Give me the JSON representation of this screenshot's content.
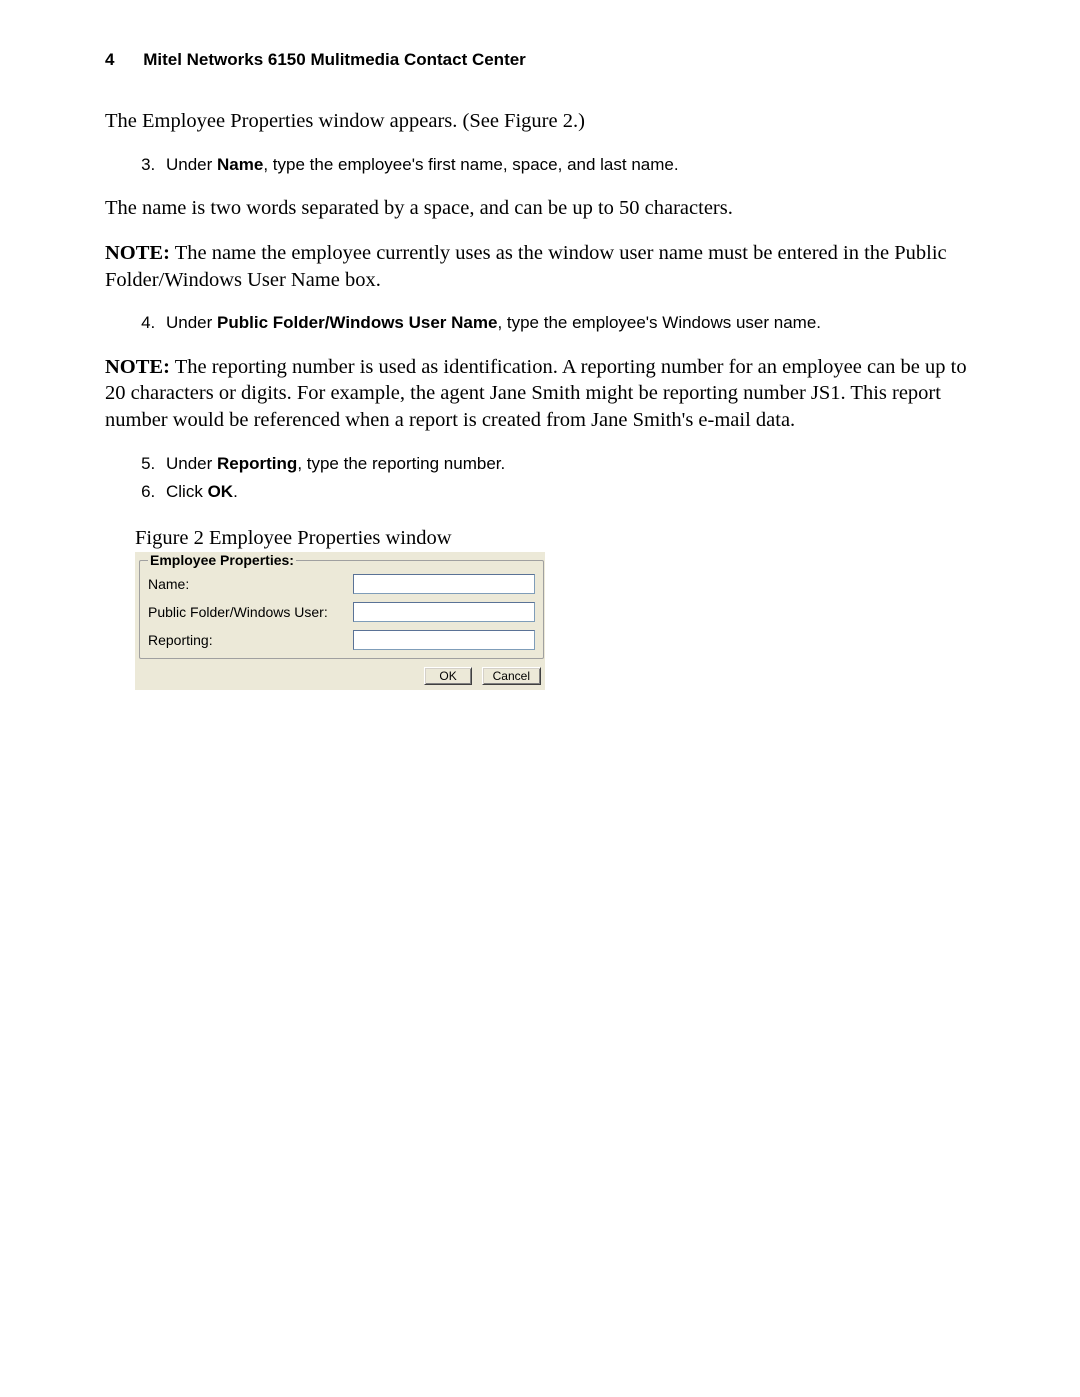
{
  "header": {
    "page_number": "4",
    "title": "Mitel Networks 6150 Mulitmedia Contact Center"
  },
  "paragraphs": {
    "intro": "The Employee Properties window appears. (See Figure 2.)",
    "name_rule": "The name is two words separated by a space, and can be up to 50 characters.",
    "note1_label": "NOTE:",
    "note1_body": " The name the employee currently uses as the window user name must be entered in the Public Folder/Windows User Name box.",
    "note2_label": "NOTE:",
    "note2_body": " The reporting number is used as identification. A reporting number for an employee can be up to 20 characters or digits. For example, the agent Jane Smith might be reporting number JS1. This report number would be referenced when a report is created from Jane Smith's e-mail data."
  },
  "steps": {
    "s3_prefix": "Under ",
    "s3_bold": "Name",
    "s3_suffix": ", type the employee's first name, space, and last name.",
    "s4_prefix": "Under ",
    "s4_bold": "Public Folder/Windows User Name",
    "s4_suffix": ", type the employee's Windows user name.",
    "s5_prefix": "Under ",
    "s5_bold": "Reporting",
    "s5_suffix": ", type the reporting number.",
    "s6_prefix": "Click ",
    "s6_bold": "OK",
    "s6_suffix": "."
  },
  "figure": {
    "caption": "Figure 2   Employee Properties window"
  },
  "dialog": {
    "legend": "Employee Properties:",
    "labels": {
      "name": "Name:",
      "public_folder": "Public Folder/Windows User:",
      "reporting": "Reporting:"
    },
    "values": {
      "name": "",
      "public_folder": "",
      "reporting": ""
    },
    "buttons": {
      "ok": "OK",
      "cancel": "Cancel"
    }
  }
}
